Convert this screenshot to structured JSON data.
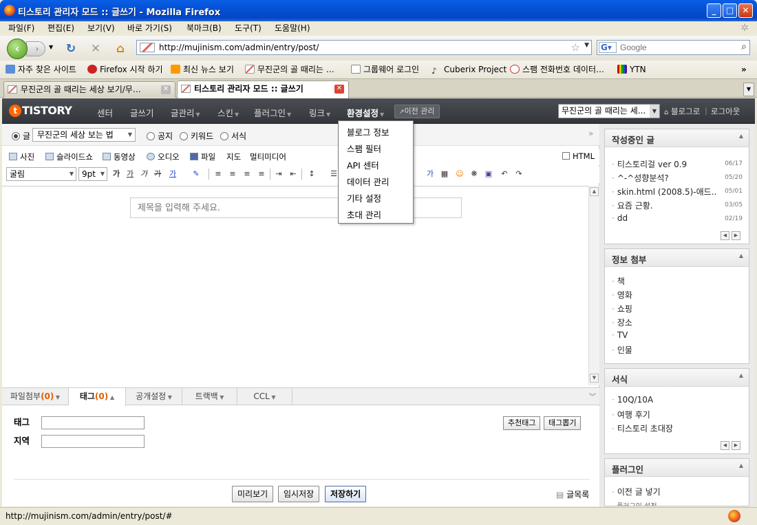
{
  "window": {
    "title": "티스토리 관리자 모드 :: 글쓰기 - Mozilla Firefox"
  },
  "menu": [
    "파일(F)",
    "편집(E)",
    "보기(V)",
    "바로 가기(S)",
    "북마크(B)",
    "도구(T)",
    "도움말(H)"
  ],
  "address": {
    "url": "http://mujinism.com/admin/entry/post/"
  },
  "search": {
    "placeholder": "Google"
  },
  "bookmarks": [
    "자주 찾은 사이트",
    "Firefox 시작 하기",
    "최신 뉴스 보기",
    "무진군의 골 때리는 …",
    "그룹웨어 로그인",
    "Cuberix Project",
    "스팸 전화번호 데이터…",
    "YTN"
  ],
  "tabs": [
    {
      "label": "무진군의 골 때리는 세상 보기/무…"
    },
    {
      "label": "티스토리 관리자 모드 :: 글쓰기"
    }
  ],
  "tistory": {
    "logo": "TISTORY",
    "nav": [
      "센터",
      "글쓰기",
      "글관리",
      "스킨",
      "플러그인",
      "링크",
      "환경설정"
    ],
    "prev_manage": "이전 관리",
    "blog_select": "무진군의 골 때리는 세...",
    "blog_home": "블로그로",
    "logout": "로그아웃"
  },
  "dropdown": [
    "블로그 정보",
    "스팸 필터",
    "API 센터",
    "데이터 관리",
    "기타 설정",
    "초대 관리"
  ],
  "editor": {
    "type_radio": "글",
    "category": "무진군의 세상 보는 법",
    "radios": [
      "공지",
      "키워드",
      "서식"
    ],
    "media": [
      "사진",
      "슬라이드쇼",
      "동영상",
      "오디오",
      "파일",
      "지도",
      "멀티미디어"
    ],
    "html_label": "HTML",
    "font": "굴림",
    "size": "9pt",
    "title_placeholder": "제목을 입력해 주세요.",
    "bottom_tabs": [
      {
        "label": "파일첨부",
        "count": "(0)"
      },
      {
        "label": "태그",
        "count": "(0)"
      },
      {
        "label": "공개설정",
        "count": ""
      },
      {
        "label": "트랙백",
        "count": ""
      },
      {
        "label": "CCL",
        "count": ""
      }
    ],
    "tag_label": "태그",
    "region_label": "지역",
    "recommend_tag": "추천태그",
    "extract_tag": "태그뽑기",
    "preview": "미리보기",
    "temp_save": "임시저장",
    "save": "저장하기",
    "list": "글목록"
  },
  "sidebar": {
    "writing": {
      "title": "작성중인 글",
      "items": [
        {
          "text": "티스토리걸 ver 0.9",
          "date": "06/17"
        },
        {
          "text": "^-^성향분석?",
          "date": "05/20"
        },
        {
          "text": "skin.html (2008.5)-애드..",
          "date": "05/01"
        },
        {
          "text": "요즘 근황.",
          "date": "03/05"
        },
        {
          "text": "dd",
          "date": "02/19"
        }
      ]
    },
    "info": {
      "title": "정보 첨부",
      "items": [
        "책",
        "영화",
        "쇼핑",
        "장소",
        "TV",
        "인물"
      ]
    },
    "form": {
      "title": "서식",
      "items": [
        "10Q/10A",
        "여행 후기",
        "티스토리 초대장"
      ]
    },
    "plugin": {
      "title": "플러그인",
      "items": [
        "이전 글 넣기",
        "플러그인 설정"
      ]
    }
  },
  "status": {
    "text": "http://mujinism.com/admin/entry/post/#"
  }
}
